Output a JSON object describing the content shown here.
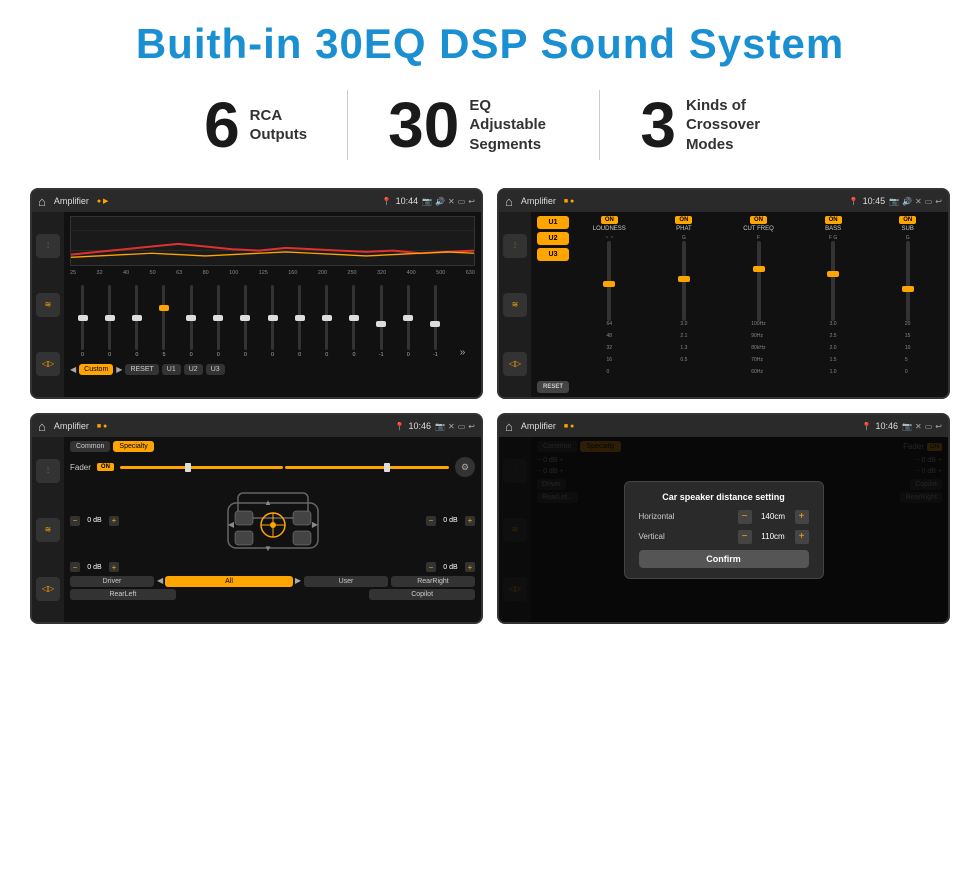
{
  "title": "Buith-in 30EQ DSP Sound System",
  "stats": [
    {
      "number": "6",
      "label": "RCA\nOutputs"
    },
    {
      "number": "30",
      "label": "EQ Adjustable\nSegments"
    },
    {
      "number": "3",
      "label": "Kinds of\nCrossover Modes"
    }
  ],
  "screen1": {
    "statusTitle": "Amplifier",
    "statusTime": "10:44",
    "freqLabels": [
      "25",
      "32",
      "40",
      "50",
      "63",
      "80",
      "100",
      "125",
      "160",
      "200",
      "250",
      "320",
      "400",
      "500",
      "630"
    ],
    "sliderValues": [
      "0",
      "0",
      "0",
      "5",
      "0",
      "0",
      "0",
      "0",
      "0",
      "0",
      "0",
      "-1",
      "0",
      "-1"
    ],
    "bottomBtns": [
      "Custom",
      "RESET",
      "U1",
      "U2",
      "U3"
    ]
  },
  "screen2": {
    "statusTitle": "Amplifier",
    "statusTime": "10:45",
    "presets": [
      "U1",
      "U2",
      "U3"
    ],
    "channels": [
      {
        "on": true,
        "label": "LOUDNESS"
      },
      {
        "on": true,
        "label": "PHAT"
      },
      {
        "on": true,
        "label": "CUT FREQ"
      },
      {
        "on": true,
        "label": "BASS"
      },
      {
        "on": true,
        "label": "SUB"
      }
    ],
    "resetLabel": "RESET"
  },
  "screen3": {
    "statusTitle": "Amplifier",
    "statusTime": "10:46",
    "tabs": [
      "Common",
      "Specialty"
    ],
    "faderLabel": "Fader",
    "faderOn": "ON",
    "speakerRows": [
      {
        "left": "0 dB",
        "right": "0 dB"
      },
      {
        "left": "0 dB",
        "right": "0 dB"
      }
    ],
    "bottomBtns": [
      "Driver",
      "",
      "",
      "",
      "User",
      "RearRight"
    ],
    "rearLeft": "RearLeft",
    "all": "All",
    "driver": "Driver",
    "copilot": "Copilot",
    "user": "User",
    "rearRight": "RearRight"
  },
  "screen4": {
    "statusTitle": "Amplifier",
    "statusTime": "10:46",
    "tabs": [
      "Common",
      "Specialty"
    ],
    "dialog": {
      "title": "Car speaker distance setting",
      "horizontal": {
        "label": "Horizontal",
        "value": "140cm"
      },
      "vertical": {
        "label": "Vertical",
        "value": "110cm"
      },
      "confirmLabel": "Confirm",
      "rightLabel": "0 dB",
      "rightLabel2": "0 dB"
    },
    "driver": "Driver",
    "copilot": "Copilot",
    "rearLeft": "RearLef...",
    "rearRight": "RearRight"
  }
}
